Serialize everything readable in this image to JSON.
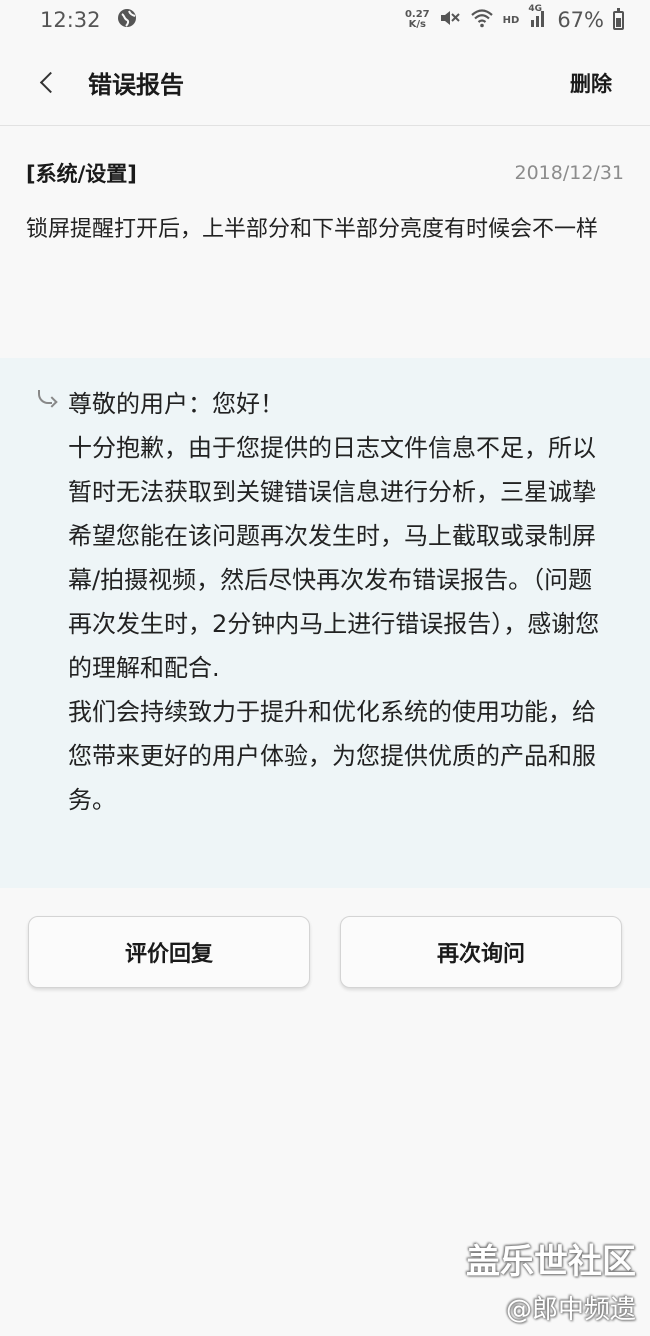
{
  "status_bar": {
    "time": "12:32",
    "net_speed_value": "0.27",
    "net_speed_unit": "K/s",
    "hd_label": "HD",
    "network_label": "4G",
    "battery_text": "67%",
    "battery_level": 0.67
  },
  "app_bar": {
    "title": "错误报告",
    "delete_label": "删除"
  },
  "question": {
    "category": "[系统/设置]",
    "date": "2018/12/31",
    "text": "锁屏提醒打开后，上半部分和下半部分亮度有时候会不一样"
  },
  "reply": {
    "paragraphs": [
      "尊敬的用户：您好！",
      "十分抱歉，由于您提供的日志文件信息不足，所以暂时无法获取到关键错误信息进行分析，三星诚挚希望您能在该问题再次发生时，马上截取或录制屏幕/拍摄视频，然后尽快再次发布错误报告。（问题再次发生时，2分钟内马上进行错误报告），感谢您的理解和配合.",
      "我们会持续致力于提升和优化系统的使用功能，给您带来更好的用户体验，为您提供优质的产品和服务。"
    ]
  },
  "actions": {
    "rate_label": "评价回复",
    "ask_again_label": "再次询问"
  },
  "watermark": {
    "title": "盖乐世社区",
    "user": "@郎中频遗"
  }
}
